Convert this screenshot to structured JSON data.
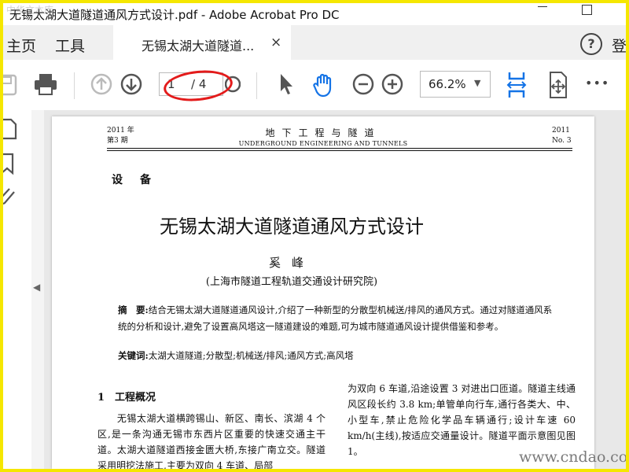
{
  "window": {
    "title": "无锡太湖大道隧道通风方式设计.pdf - Adobe Acrobat Pro DC",
    "corner_watermark": "中华文本库"
  },
  "tabs": {
    "home": "主页",
    "tools": "工具",
    "document": "无锡太湖大道隧道...",
    "close": "×",
    "help": "?",
    "login": "登"
  },
  "toolbar": {
    "page_current": "1",
    "page_total": "/ 4",
    "zoom": "66.2%",
    "zoom_dropdown": "▼",
    "more": "•••"
  },
  "left_panel": {
    "collapse_arrow": "◀"
  },
  "document": {
    "header": {
      "year_cn": "2011 年",
      "issue_cn": "第3 期",
      "journal_cn": "地下工程与隧道",
      "journal_en": "UNDERGROUND ENGINEERING AND TUNNELS",
      "year": "2011",
      "issue": "No. 3"
    },
    "section_tag": "设备",
    "title": "无锡太湖大道隧道通风方式设计",
    "author": "奚峰",
    "affiliation": "(上海市隧道工程轨道交通设计研究院)",
    "abstract_label": "摘　要:",
    "abstract_text": "结合无锡太湖大道隧道通风设计,介绍了一种新型的分散型机械送/排风的通风方式。通过对隧道通风系统的分析和设计,避免了设置高风塔这一隧道建设的难题,可为城市隧道通风设计提供借鉴和参考。",
    "keywords_label": "关键词:",
    "keywords_text": "太湖大道隧道;分散型;机械送/排风;通风方式;高风塔",
    "section1_heading": "1　工程概况",
    "col1_text": "　　无锡太湖大道横跨锡山、新区、南长、滨湖 4 个区,是一条沟通无锡市东西片区重要的快速交通主干道。太湖大道隧道西接金匮大桥,东接广南立交。隧道采用明挖法施工,主要为双向 4 车道、局部",
    "col2_text": "为双向 6 车道,沿途设置 3 对进出口匝道。隧道主线通风区段长约 3.8 km;单管单向行车,通行各类大、中、小型车,禁止危险化学品车辆通行;设计车速 60 km/h(主线),按适应交通量设计。隧道平面示意图见图 1。"
  },
  "site_watermark": "www.cndao.com",
  "colors": {
    "frame": "#f5e700",
    "accent_blue": "#1473e6",
    "annotation": "#e31b1b"
  }
}
